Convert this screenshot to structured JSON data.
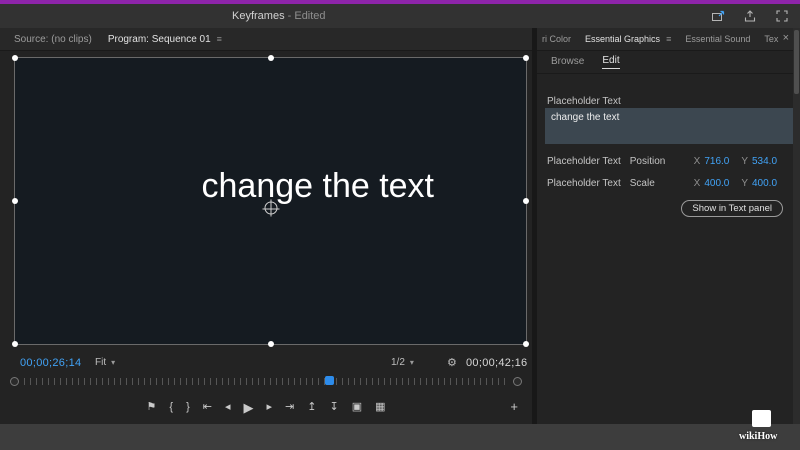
{
  "chrome": {
    "title": "Keyframes",
    "title_suffix": " - Edited",
    "accent_color": "#8e24aa",
    "titlebar_icons": [
      {
        "name": "quick-export-icon"
      },
      {
        "name": "share-icon"
      },
      {
        "name": "fullscreen-icon"
      }
    ]
  },
  "colors": {
    "value_blue": "#41a2f5",
    "playhead_blue": "#2d8ceb",
    "canvas_background": "#151b21",
    "panel_background": "#232323"
  },
  "monitor_panel": {
    "tabs": [
      {
        "label": "Source: (no clips)"
      },
      {
        "label": "Program: Sequence 01",
        "menu_icon": "≡"
      }
    ],
    "canvas": {
      "text": "change the text"
    },
    "controls": {
      "current_timecode": "00;00;26;14",
      "fit_label": "Fit",
      "zoom_label": "1/2",
      "chevron_icon": "▾",
      "wrench_icon": "⚙",
      "duration_timecode": "00;00;42;16"
    },
    "transport": {
      "icons": [
        {
          "name": "add-marker",
          "glyph": "⚑"
        },
        {
          "name": "mark-in",
          "glyph": "{"
        },
        {
          "name": "mark-out",
          "glyph": "}"
        },
        {
          "name": "go-to-in",
          "glyph": "⇤"
        },
        {
          "name": "step-back",
          "glyph": "◂"
        },
        {
          "name": "play",
          "glyph": "▶"
        },
        {
          "name": "step-forward",
          "glyph": "▸"
        },
        {
          "name": "go-to-out",
          "glyph": "⇥"
        },
        {
          "name": "lift",
          "glyph": "↥"
        },
        {
          "name": "extract",
          "glyph": "↧"
        },
        {
          "name": "export-frame",
          "glyph": "▣"
        },
        {
          "name": "comparison-view",
          "glyph": "▦"
        }
      ],
      "add_button": "+"
    }
  },
  "graphics_panel": {
    "tabs": [
      {
        "label": "ri Color"
      },
      {
        "label": "Essential Graphics",
        "menu_icon": "≡"
      },
      {
        "label": "Essential Sound"
      },
      {
        "label": "Tex"
      }
    ],
    "close_icon": "×",
    "subtabs": [
      {
        "label": "Browse"
      },
      {
        "label": "Edit"
      }
    ],
    "layers": {
      "header": "Placeholder Text",
      "selected_item": "change the text"
    },
    "properties": [
      {
        "name": "Placeholder Text",
        "prop": "Position",
        "x_label": "X",
        "x_value": "716.0",
        "y_label": "Y",
        "y_value": "534.0"
      },
      {
        "name": "Placeholder Text",
        "prop": "Scale",
        "x_label": "X",
        "x_value": "400.0",
        "y_label": "Y",
        "y_value": "400.0"
      }
    ],
    "action_button": "Show in Text panel"
  },
  "watermark": {
    "text": "wikiHow"
  }
}
